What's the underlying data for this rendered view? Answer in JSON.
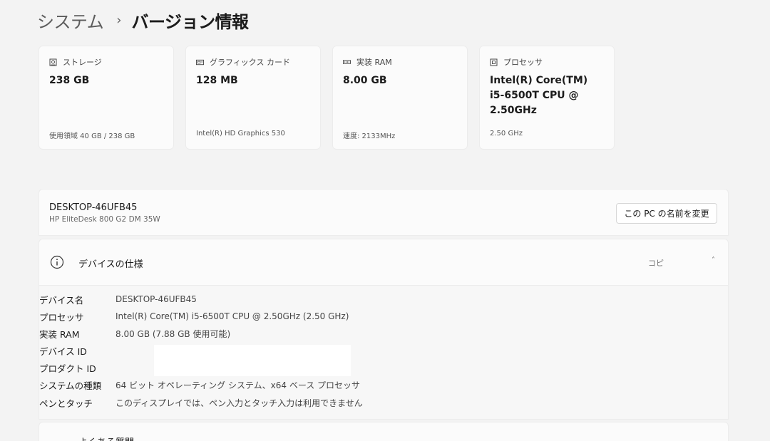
{
  "breadcrumb": {
    "parent": "システム",
    "separator": "›",
    "current": "バージョン情報"
  },
  "cards": [
    {
      "icon": "storage-icon",
      "label": "ストレージ",
      "value": "238 GB",
      "sub": "使用領域 40 GB / 238 GB"
    },
    {
      "icon": "graphics-card-icon",
      "label": "グラフィックス カード",
      "value": "128 MB",
      "sub": "Intel(R) HD Graphics 530"
    },
    {
      "icon": "ram-icon",
      "label": "実装 RAM",
      "value": "8.00 GB",
      "sub": "速度: 2133MHz"
    },
    {
      "icon": "processor-icon",
      "label": "プロセッサ",
      "value": "Intel(R) Core(TM) i5-6500T CPU @ 2.50GHz",
      "sub": "2.50 GHz"
    }
  ],
  "device": {
    "name": "DESKTOP-46UFB45",
    "model": "HP EliteDesk 800 G2 DM 35W",
    "rename_label": "この PC の名前を変更"
  },
  "specs": {
    "title": "デバイスの仕様",
    "copy_label": "コピ",
    "chevron": "˄",
    "rows": [
      {
        "key": "デバイス名",
        "value": "DESKTOP-46UFB45"
      },
      {
        "key": "プロセッサ",
        "value": "Intel(R) Core(TM) i5-6500T CPU @ 2.50GHz (2.50 GHz)"
      },
      {
        "key": "実装 RAM",
        "value": "8.00 GB (7.88 GB 使用可能)"
      },
      {
        "key": "デバイス ID",
        "value": ""
      },
      {
        "key": "プロダクト ID",
        "value": ""
      },
      {
        "key": "システムの種類",
        "value": "64 ビット オペレーティング システム、x64 ベース プロセッサ"
      },
      {
        "key": "ペンとタッチ",
        "value": "このディスプレイでは、ペン入力とタッチ入力は利用できません"
      }
    ]
  },
  "faq": {
    "label": "よくある質問"
  }
}
